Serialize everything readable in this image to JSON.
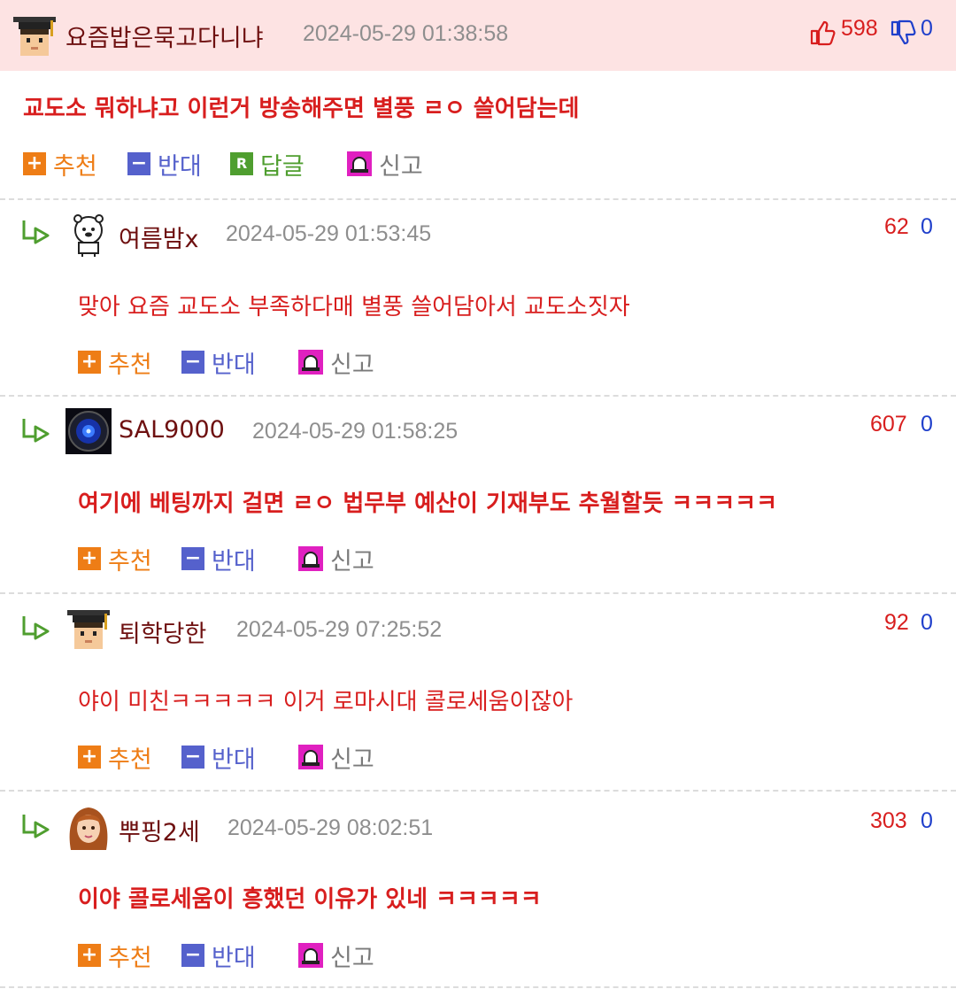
{
  "top": {
    "nick": "요즘밥은묵고다니냐",
    "date": "2024-05-29 01:38:58",
    "up": "598",
    "down": "0",
    "body": "교도소 뭐하냐고 이런거 방송해주면 별풍 ㄹㅇ 쓸어담는데",
    "actions": {
      "recommend": "추천",
      "oppose": "반대",
      "reply": "답글",
      "report": "신고",
      "reply_badge": "R"
    }
  },
  "replies": [
    {
      "nick": "여름밤x",
      "date": "2024-05-29 01:53:45",
      "up": "62",
      "down": "0",
      "body": "맞아 요즘 교도소 부족하다매 별풍 쓸어담아서 교도소짓자"
    },
    {
      "nick": "SAL9000",
      "date": "2024-05-29 01:58:25",
      "up": "607",
      "down": "0",
      "body": "여기에 베팅까지 걸면 ㄹㅇ 법무부 예산이 기재부도 추월할듯 ㅋㅋㅋㅋㅋ"
    },
    {
      "nick": "퇴학당한",
      "date": "2024-05-29 07:25:52",
      "up": "92",
      "down": "0",
      "body": "야이 미친ㅋㅋㅋㅋㅋ 이거 로마시대 콜로세움이잖아"
    },
    {
      "nick": "뿌핑2세",
      "date": "2024-05-29 08:02:51",
      "up": "303",
      "down": "0",
      "body": "이야 콜로세움이 흥했던 이유가 있네 ㅋㅋㅋㅋㅋ"
    }
  ],
  "reply_actions": {
    "recommend": "추천",
    "oppose": "반대",
    "report": "신고"
  },
  "icons": {
    "up": "thumbs-up-icon",
    "down": "thumbs-down-icon",
    "reply_arrow": "reply-arrow-icon",
    "report": "siren-icon"
  },
  "colors": {
    "header_bg": "#fde3e3",
    "red": "#d81e1e",
    "blue": "#1f3fcb",
    "orange": "#ee7d16",
    "purple_blue": "#5561cc",
    "green": "#4f9e2f"
  }
}
